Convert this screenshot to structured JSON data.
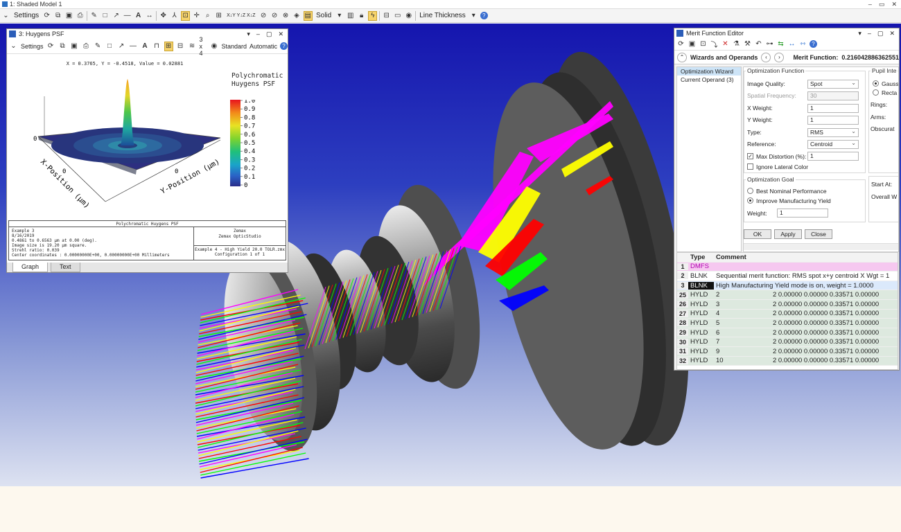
{
  "app": {
    "title": "1: Shaded Model 1",
    "window_controls": [
      "–",
      "▭",
      "✕"
    ]
  },
  "toolbar": {
    "settings": "Settings",
    "axes_text": "X↓Y  Y↓Z  X↓Z",
    "solid": "Solid",
    "line_thickness": "Line Thickness"
  },
  "psf": {
    "title": "3: Huygens PSF",
    "settings": "Settings",
    "grid_option": "3 x 4",
    "standard": "Standard",
    "automatic": "Automatic",
    "readout": "X = 0.3765, Y = -0.4518, Value = 0.02881",
    "legend_title_line1": "Polychromatic",
    "legend_title_line2": "Huygens PSF",
    "legend_ticks": [
      "1.0",
      "0.9",
      "0.8",
      "0.7",
      "0.6",
      "0.5",
      "0.4",
      "0.3",
      "0.2",
      "0.1",
      "0"
    ],
    "axis_zero": "0",
    "x_axis_label": "X-Position (µm)",
    "y_axis_label": "Y-Position (µm)",
    "info_header": "Polychromatic Huygens PSF",
    "info_left": [
      "Example 3",
      "8/16/2019",
      "0.4861 to 0.6563 µm at 0.00 (deg).",
      "Image size is 19.20 µm square.",
      "Strehl ratio: 0.039",
      "Center coordinates  :    0.00000000E+00,   0.00000000E+00 Millimeters"
    ],
    "info_company": "Zemax",
    "info_product": "Zemax OpticStudio",
    "info_file": "Example 4 - High Yield 20.0 TOLR.zmx",
    "info_config": "Configuration 1 of 1",
    "tabs": [
      "Graph",
      "Text"
    ]
  },
  "mfe": {
    "title": "Merit Function Editor",
    "wizards_label": "Wizards and Operands",
    "merit_label": "Merit Function:",
    "merit_value": "0.216042886362551",
    "wizard_list": [
      "Optimization Wizard",
      "Current Operand (3)"
    ],
    "opt_function_title": "Optimization Function",
    "image_quality_label": "Image Quality:",
    "image_quality_value": "Spot",
    "spatial_freq_label": "Spatial Frequency:",
    "spatial_freq_value": "30",
    "x_weight_label": "X Weight:",
    "x_weight_value": "1",
    "y_weight_label": "Y Weight:",
    "y_weight_value": "1",
    "type_label": "Type:",
    "type_value": "RMS",
    "reference_label": "Reference:",
    "reference_value": "Centroid",
    "max_distortion_label": "Max Distortion (%):",
    "max_distortion_value": "1",
    "ignore_lateral_label": "Ignore Lateral Color",
    "pupil_title": "Pupil Inte",
    "pupil_options": [
      "Gauss",
      "Recta"
    ],
    "rings_label": "Rings:",
    "arms_label": "Arms:",
    "obscuration_label": "Obscurat",
    "goal_title": "Optimization Goal",
    "goal_options": [
      "Best Nominal Performance",
      "Improve Manufacturing Yield"
    ],
    "weight_label": "Weight:",
    "weight_value": "1",
    "start_at_label": "Start At:",
    "overall_label": "Overall W",
    "buttons": [
      "OK",
      "Apply",
      "Close"
    ],
    "table": {
      "headers": [
        "Type",
        "Comment"
      ],
      "rows": [
        {
          "num": "1",
          "type": "DMFS",
          "comment": ""
        },
        {
          "num": "2",
          "type": "BLNK",
          "comment": "Sequential merit function: RMS spot x+y centroid X Wgt = 1"
        },
        {
          "num": "3",
          "type": "BLNK",
          "comment": "High Manufacturing Yield mode is on, weight = 1.0000"
        },
        {
          "num": "25",
          "type": "HYLD",
          "comment": "2",
          "values": "2 0.00000 0.00000 0.33571 0.00000"
        },
        {
          "num": "26",
          "type": "HYLD",
          "comment": "3",
          "values": "2 0.00000 0.00000 0.33571 0.00000"
        },
        {
          "num": "27",
          "type": "HYLD",
          "comment": "4",
          "values": "2 0.00000 0.00000 0.33571 0.00000"
        },
        {
          "num": "28",
          "type": "HYLD",
          "comment": "5",
          "values": "2 0.00000 0.00000 0.33571 0.00000"
        },
        {
          "num": "29",
          "type": "HYLD",
          "comment": "6",
          "values": "2 0.00000 0.00000 0.33571 0.00000"
        },
        {
          "num": "30",
          "type": "HYLD",
          "comment": "7",
          "values": "2 0.00000 0.00000 0.33571 0.00000"
        },
        {
          "num": "31",
          "type": "HYLD",
          "comment": "9",
          "values": "2 0.00000 0.00000 0.33571 0.00000"
        },
        {
          "num": "32",
          "type": "HYLD",
          "comment": "10",
          "values": "2 0.00000 0.00000 0.33571 0.00000"
        }
      ]
    }
  },
  "colors": {
    "viewport_top": "#1515ae",
    "beam_colors": [
      "#ff00ff",
      "#ffff00",
      "#ff0000",
      "#00ff00",
      "#0000ff"
    ]
  }
}
